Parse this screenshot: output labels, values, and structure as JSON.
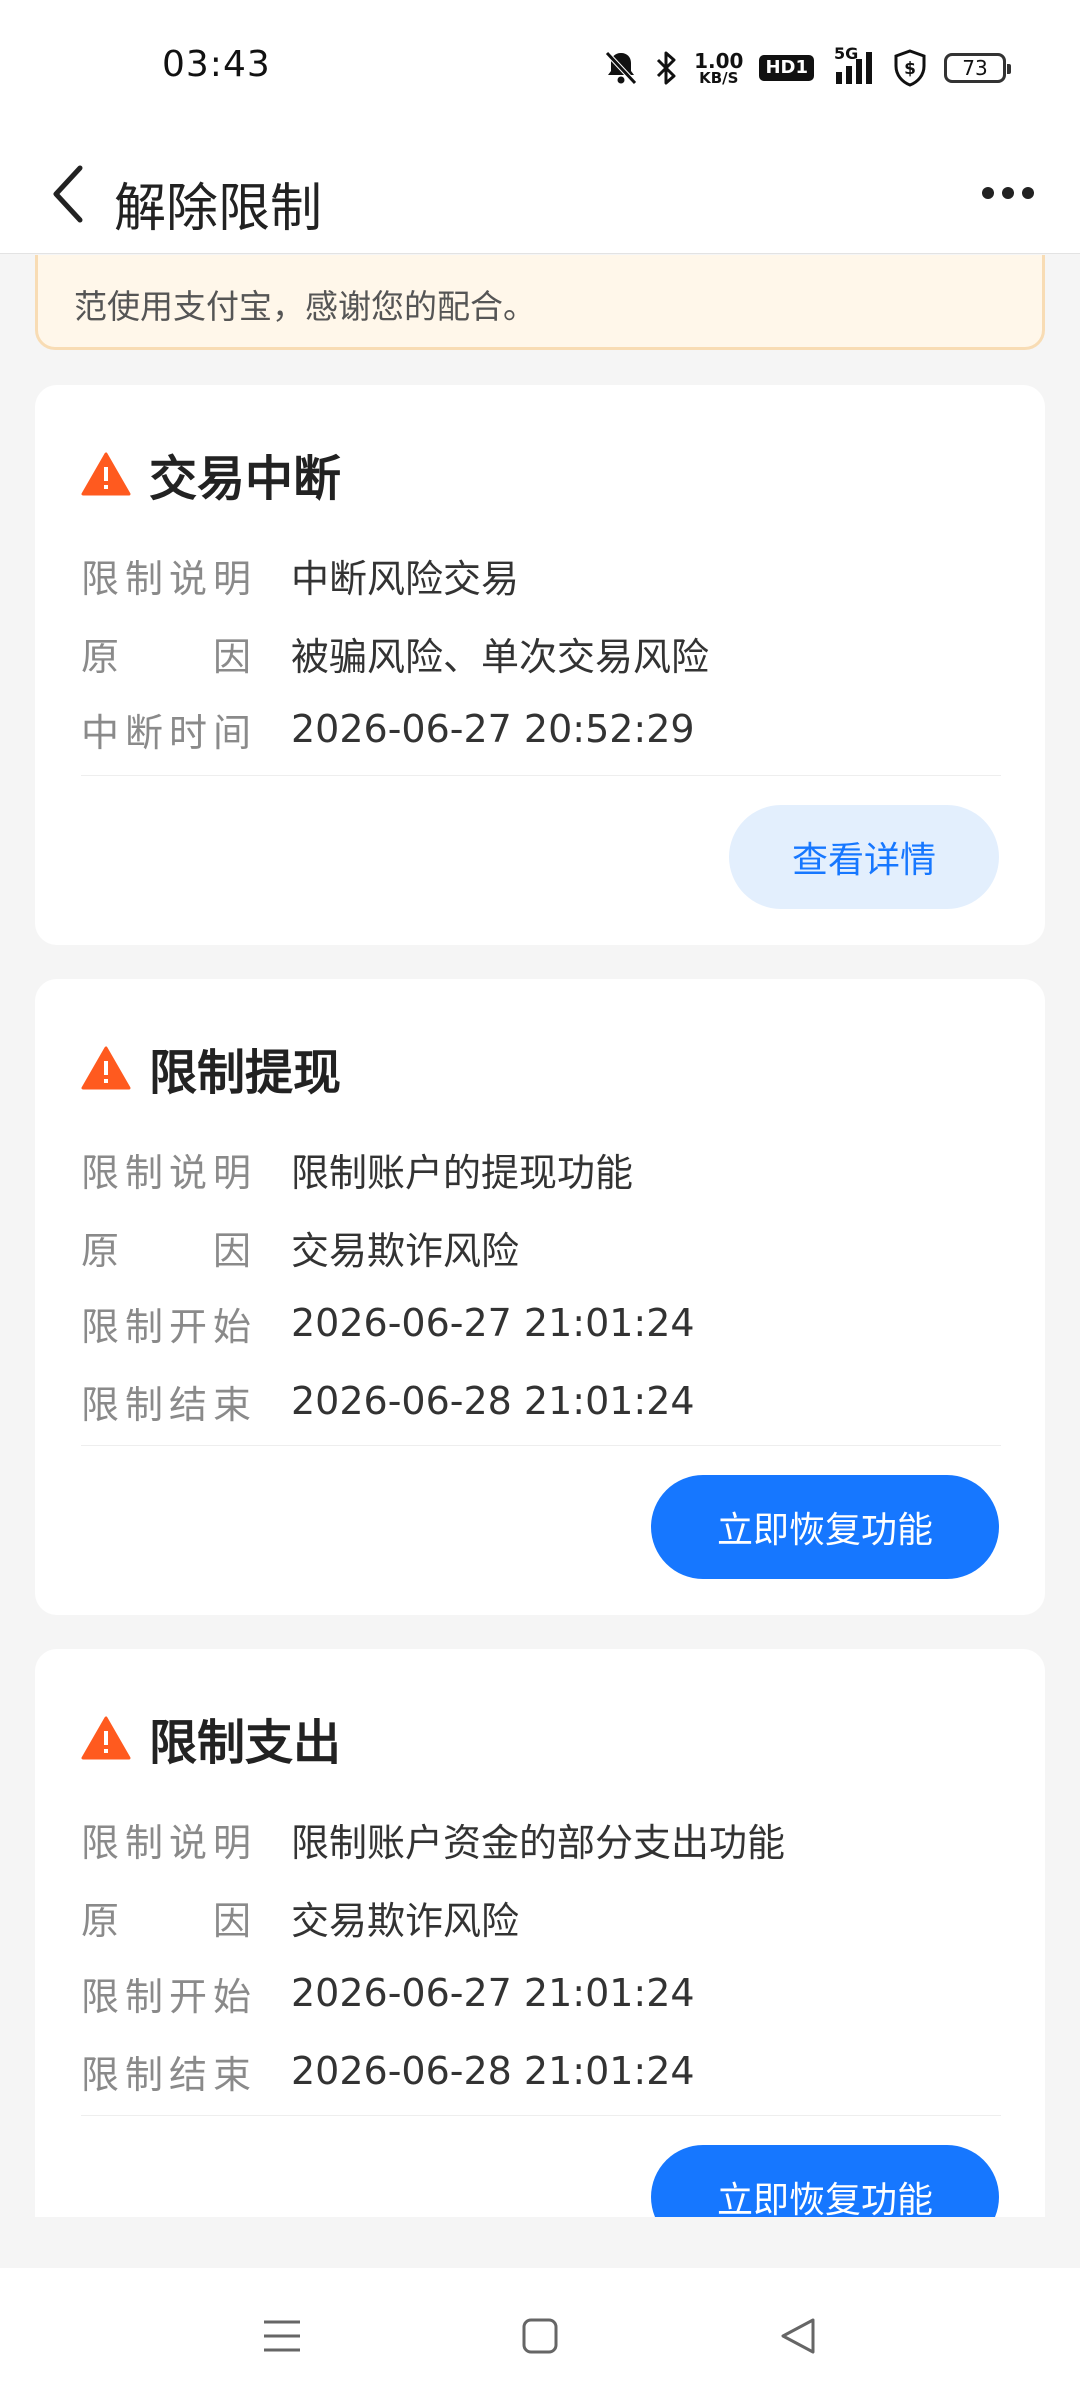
{
  "status_bar": {
    "time": "03:43",
    "speed_value": "1.00",
    "speed_unit": "KB/S",
    "hd_label": "HD1",
    "network": "5G",
    "battery": "73"
  },
  "header": {
    "title": "解除限制"
  },
  "notice": {
    "text": "范使用支付宝，感谢您的配合。"
  },
  "cards": [
    {
      "title": "交易中断",
      "rows": [
        {
          "label": [
            "限",
            "制",
            "说",
            "明"
          ],
          "value": "中断风险交易"
        },
        {
          "label": [
            "原",
            "因"
          ],
          "value": "被骗风险、单次交易风险"
        },
        {
          "label": [
            "中",
            "断",
            "时",
            "间"
          ],
          "value": "2026-06-27 20:52:29"
        }
      ],
      "button": "查看详情"
    },
    {
      "title": "限制提现",
      "rows": [
        {
          "label": [
            "限",
            "制",
            "说",
            "明"
          ],
          "value": "限制账户的提现功能"
        },
        {
          "label": [
            "原",
            "因"
          ],
          "value": "交易欺诈风险"
        },
        {
          "label": [
            "限",
            "制",
            "开",
            "始"
          ],
          "value": "2026-06-27 21:01:24"
        },
        {
          "label": [
            "限",
            "制",
            "结",
            "束"
          ],
          "value": "2026-06-28 21:01:24"
        }
      ],
      "button": "立即恢复功能"
    },
    {
      "title": "限制支出",
      "rows": [
        {
          "label": [
            "限",
            "制",
            "说",
            "明"
          ],
          "value": "限制账户资金的部分支出功能"
        },
        {
          "label": [
            "原",
            "因"
          ],
          "value": "交易欺诈风险"
        },
        {
          "label": [
            "限",
            "制",
            "开",
            "始"
          ],
          "value": "2026-06-27 21:01:24"
        },
        {
          "label": [
            "限",
            "制",
            "结",
            "束"
          ],
          "value": "2026-06-28 21:01:24"
        }
      ],
      "button": "立即恢复功能"
    }
  ],
  "colors": {
    "primary": "#1677ff",
    "warning": "#ff5a1f",
    "notice_bg": "#fff7ea"
  },
  "icons": {
    "back": "chevron-left-icon",
    "more": "more-dots-icon",
    "warning": "warning-triangle-icon",
    "nav_menu": "menu-icon",
    "nav_home": "home-square-icon",
    "nav_back": "back-triangle-icon"
  }
}
